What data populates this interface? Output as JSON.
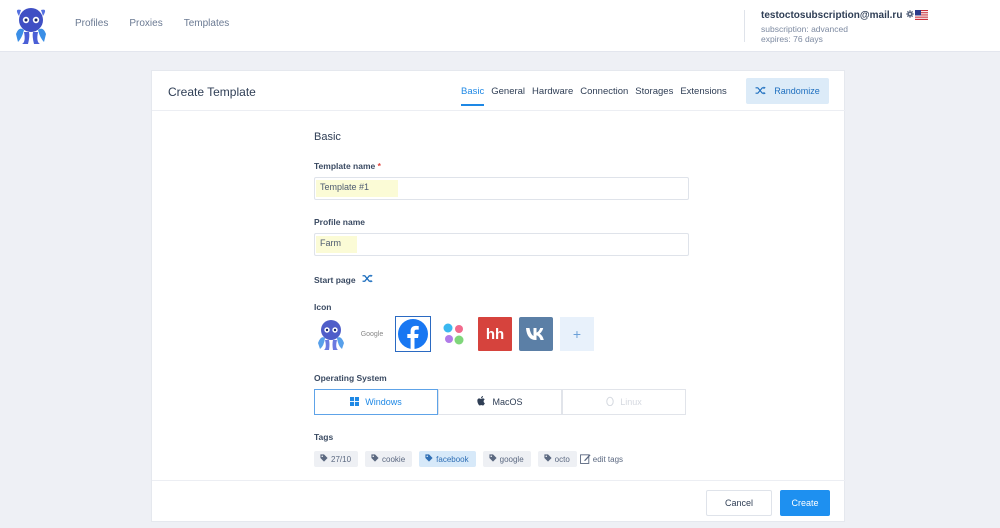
{
  "header": {
    "nav": [
      "Profiles",
      "Proxies",
      "Templates"
    ],
    "email": "testoctosubscription@mail.ru",
    "subscription": "subscription: advanced",
    "expires": "expires: 76 days"
  },
  "card": {
    "title": "Create Template",
    "tabs": [
      "Basic",
      "General",
      "Hardware",
      "Connection",
      "Storages",
      "Extensions"
    ],
    "active_tab": "Basic",
    "randomize_label": "Randomize"
  },
  "form": {
    "section_title": "Basic",
    "template_name_label": "Template name",
    "required_mark": "*",
    "template_name_value": "Template #1",
    "profile_name_label": "Profile name",
    "profile_name_value": "Farm",
    "start_page_label": "Start page",
    "icon_label": "Icon",
    "icons": [
      "octo",
      "google",
      "facebook",
      "dots",
      "hh",
      "vk"
    ],
    "icon_google_text": "Google",
    "icon_hh_text": "hh",
    "icon_add": "+",
    "os_label": "Operating System",
    "os_options": [
      "Windows",
      "MacOS",
      "Linux"
    ],
    "os_selected": "Windows",
    "tags_label": "Tags",
    "tags": [
      "27/10",
      "cookie",
      "facebook",
      "google",
      "octo"
    ],
    "tag_selected": "facebook",
    "edit_tags": "edit tags"
  },
  "footer": {
    "cancel": "Cancel",
    "create": "Create"
  },
  "colors": {
    "accent": "#1e90f0",
    "tab_active": "#1e88e5",
    "randomize_bg": "#dcebf8",
    "required": "#e0413b"
  }
}
